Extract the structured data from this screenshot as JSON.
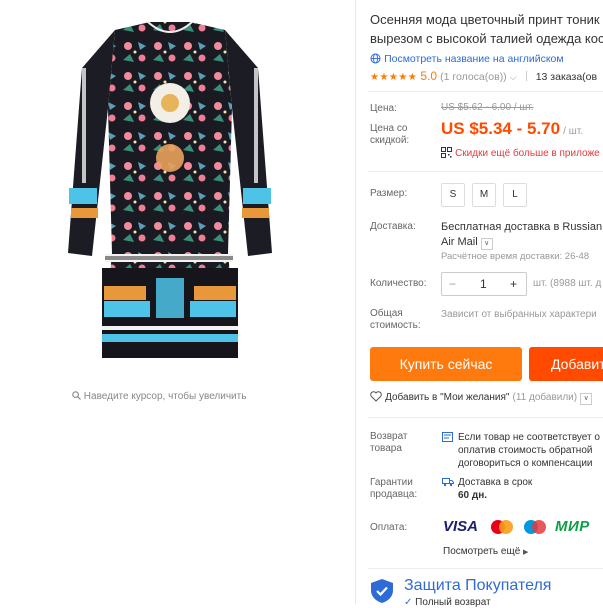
{
  "zoom_hint": "Наведите курсор, чтобы увеличить",
  "product": {
    "title_line1": "Осенняя мода цветочный принт тоник",
    "title_line2": "вырезом с высокой талией одежда кост",
    "translate_link": "Посмотреть название на английском",
    "rating_stars": "★★★★★",
    "rating_value": "5.0",
    "votes": "(1 голоса(ов))",
    "orders": "13 заказа(ов"
  },
  "price": {
    "label": "Цена:",
    "original": "US $5.62 - 6.00 / шт.",
    "discount_label": "Цена со скидкой:",
    "current": "US $5.34 - 5.70",
    "unit": "/ шт.",
    "app_promo": "Скидки ещё больше в приложе"
  },
  "size": {
    "label": "Размер:",
    "options": [
      "S",
      "M",
      "L"
    ]
  },
  "shipping": {
    "label": "Доставка:",
    "line1": "Бесплатная доставка в Russian",
    "line2": "Air Mail",
    "time": "Расчётное время доставки: 26-48"
  },
  "quantity": {
    "label": "Количество:",
    "minus": "−",
    "value": "1",
    "plus": "+",
    "stock": "шт. (8988 шт. д"
  },
  "total": {
    "label": "Общая стоимость:",
    "value": "Зависит от выбранных характери"
  },
  "actions": {
    "buy": "Купить сейчас",
    "add": "Добавит"
  },
  "wishlist": {
    "text": "Добавить в \"Мои желания\"",
    "count": "(11 добавили)"
  },
  "return_policy": {
    "label": "Возврат товара",
    "line1": "Если товар не соответствует о",
    "line2": "оплатив стоимость обратной",
    "line3": "договориться о компенсации"
  },
  "seller_guarantee": {
    "label": "Гарантии продавца:",
    "line1": "Доставка в срок",
    "line2": "60 дн."
  },
  "payment": {
    "label": "Оплата:",
    "visa": "VISA",
    "mir": "МИР",
    "more": "Посмотреть ещё"
  },
  "buyer_protection": {
    "title": "Защита Покупателя",
    "line1": "Полный возврат"
  },
  "colors": {
    "accent_orange": "#ff7a0e",
    "price_red": "#ff4a00",
    "link_blue": "#2e6bd6",
    "star": "#ff7a00"
  }
}
